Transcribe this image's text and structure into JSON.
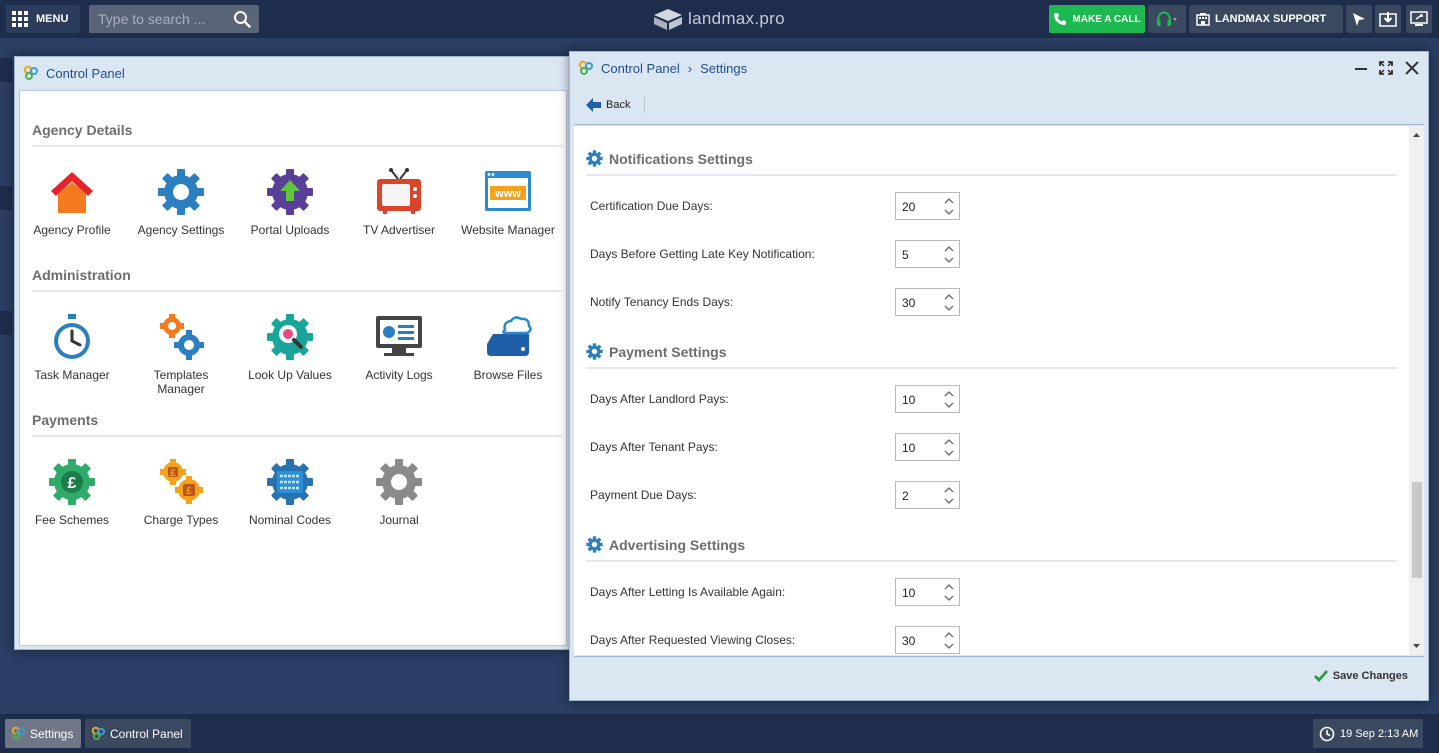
{
  "topbar": {
    "menu_label": "MENU",
    "search_placeholder": "Type to search ...",
    "logo_text": "landmax.pro",
    "call_label": "MAKE A CALL",
    "support_label": "LANDMAX SUPPORT"
  },
  "colors": {
    "topbar_bg": "#1e2d4c",
    "desktop_bg": "#2b3e63",
    "window_frame": "#dbe6f3",
    "call_green": "#1eb851",
    "title_blue": "#1f4e8c",
    "gear_blue": "#2b7fc0"
  },
  "control_panel": {
    "title": "Control Panel",
    "sections": [
      {
        "title": "Agency Details",
        "items": [
          {
            "label": "Agency Profile",
            "icon": "house-icon"
          },
          {
            "label": "Agency Settings",
            "icon": "gear-icon"
          },
          {
            "label": "Portal Uploads",
            "icon": "upload-gear-icon"
          },
          {
            "label": "TV Advertiser",
            "icon": "tv-icon"
          },
          {
            "label": "Website Manager",
            "icon": "browser-www-icon"
          }
        ]
      },
      {
        "title": "Administration",
        "items": [
          {
            "label": "Task Manager",
            "icon": "stopwatch-icon"
          },
          {
            "label": "Templates Manager",
            "icon": "gears-icon"
          },
          {
            "label": "Look Up Values",
            "icon": "magnifier-gear-icon"
          },
          {
            "label": "Activity Logs",
            "icon": "monitor-log-icon"
          },
          {
            "label": "Browse Files",
            "icon": "cloud-drive-icon"
          }
        ]
      },
      {
        "title": "Payments",
        "items": [
          {
            "label": "Fee Schemes",
            "icon": "pound-gear-icon"
          },
          {
            "label": "Charge Types",
            "icon": "coins-gears-icon"
          },
          {
            "label": "Nominal Codes",
            "icon": "code-gear-icon"
          },
          {
            "label": "Journal",
            "icon": "gray-gear-icon"
          }
        ]
      }
    ]
  },
  "settings_window": {
    "breadcrumb_root": "Control Panel",
    "breadcrumb_sep": "›",
    "breadcrumb_current": "Settings",
    "back_label": "Back",
    "save_label": "Save Changes",
    "groups": [
      {
        "title": "Notifications Settings",
        "fields": [
          {
            "label": "Certification Due Days:",
            "value": "20"
          },
          {
            "label": "Days Before Getting Late Key Notification:",
            "value": "5"
          },
          {
            "label": "Notify Tenancy Ends Days:",
            "value": "30"
          }
        ]
      },
      {
        "title": "Payment Settings",
        "fields": [
          {
            "label": "Days After Landlord Pays:",
            "value": "10"
          },
          {
            "label": "Days After Tenant Pays:",
            "value": "10"
          },
          {
            "label": "Payment Due Days:",
            "value": "2"
          }
        ]
      },
      {
        "title": "Advertising Settings",
        "fields": [
          {
            "label": "Days After Letting Is Available Again:",
            "value": "10"
          },
          {
            "label": "Days After Requested Viewing Closes:",
            "value": "30"
          }
        ]
      }
    ]
  },
  "taskbar": {
    "items": [
      {
        "label": "Settings",
        "active": true
      },
      {
        "label": "Control Panel",
        "active": false
      }
    ],
    "clock": "19 Sep 2:13 AM"
  }
}
